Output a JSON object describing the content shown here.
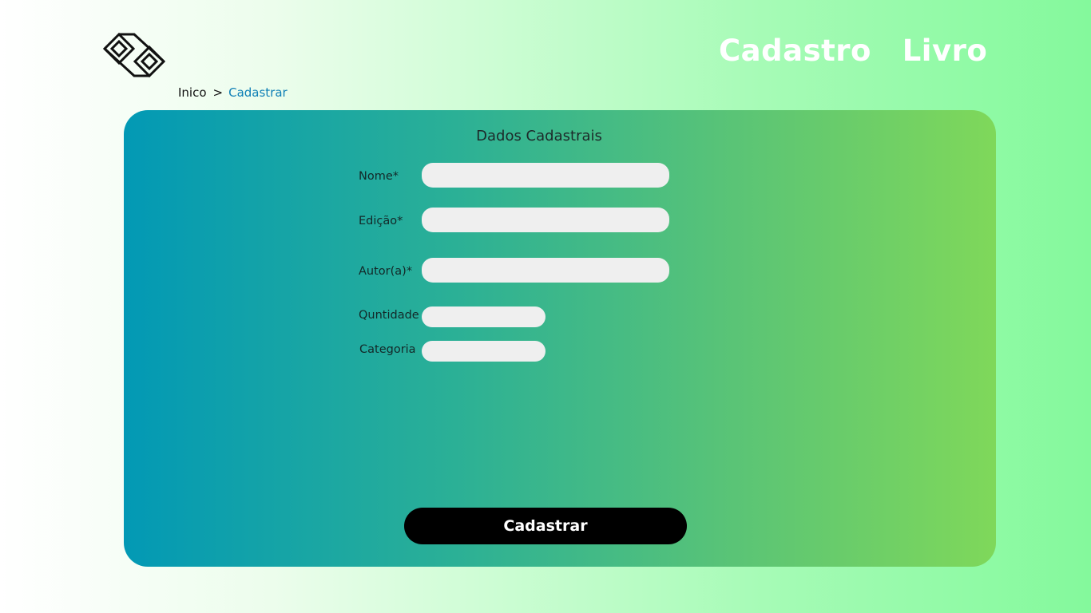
{
  "header": {
    "logo_icon": "interlocking-diamonds-logo-icon",
    "title": "Cadastro  Livro"
  },
  "breadcrumb": {
    "home": "Inico",
    "separator": ">",
    "current": "Cadastrar"
  },
  "form": {
    "title": "Dados Cadastrais",
    "fields": [
      {
        "label": "Nome*",
        "value": ""
      },
      {
        "label": "Edição*",
        "value": ""
      },
      {
        "label": "Autor(a)*",
        "value": ""
      },
      {
        "label": "Quntidade",
        "value": ""
      },
      {
        "label": "Categoria",
        "value": ""
      }
    ],
    "submit_label": "Cadastrar"
  },
  "colors": {
    "card_gradient_start": "#0299b5",
    "card_gradient_end": "#7fd85a",
    "page_gradient_end": "#84f99c",
    "breadcrumb_link": "#0e7fb6",
    "button": "#000000",
    "input_bg": "#efefef"
  }
}
